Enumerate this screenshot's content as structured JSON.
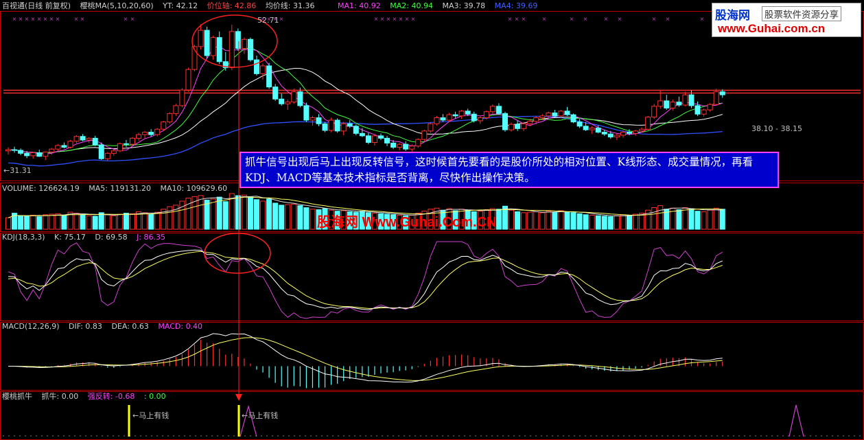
{
  "header": {
    "price": {
      "app": "百视通(日线 前复权)",
      "indicator": "樱桃MA(5,10,20,60)",
      "yt": "YT: 42.12",
      "pivot": "价位轴: 42.86",
      "avg": "均价线: 31.36",
      "ma1": "MA1: 40.92",
      "ma2": "MA2: 40.94",
      "ma3": "MA3: 39.78",
      "ma4": "MA4: 39.69"
    },
    "volume": {
      "vol": "VOLUME: 126624.19",
      "ma5": "MA5: 119131.20",
      "ma10": "MA10: 109629.60"
    },
    "kdj": {
      "name": "KDJ(18,3,3)",
      "k": "K: 75.17",
      "d": "D: 69.58",
      "j": "J: 86.35"
    },
    "macd": {
      "name": "MACD(12,26,9)",
      "dif": "DIF: 0.83",
      "dea": "DEA: 0.63",
      "macd": "MACD: 0.40"
    },
    "signal": {
      "name": "樱桃抓牛",
      "grab": "抓牛: 0.00",
      "rev": "强反转: -0.68",
      "zero": ": 0.00"
    }
  },
  "annotation": "抓牛信号出现后马上出现反转信号，这时候首先要看的是股价所处的相对位置、K线形态、成交量情况，再看KDJ、MACD等基本技术指标是否背离，尽快作出操作决策。",
  "logo": {
    "name": "股海网",
    "tag": "股票软件资源分享",
    "url": "www.Guhai.com.cn"
  },
  "watermark": "股海网 Www.Guhai.Com.CN",
  "labels": {
    "low_price": "←31.31",
    "peak_price": "52.71",
    "range": "38.10 - 38.15",
    "signal_left": "←马上有钱",
    "signal_right": "←马上有钱"
  },
  "colors": {
    "bg": "#000000",
    "up": "#ff3030",
    "down": "#54ffff",
    "ma1": "#ffffff",
    "ma2": "#ff40ff",
    "ma3": "#40ff40",
    "ma4": "#3050ff",
    "frame": "#c00000",
    "yellow": "#ffff00"
  },
  "chart_data": {
    "type": "candlestick",
    "xlabel": "",
    "ylabel": "",
    "ylim": [
      28,
      56
    ],
    "resistance": [
      42.4,
      42.86
    ],
    "ohlc": [
      [
        32.8,
        33.4,
        32.2,
        33.0
      ],
      [
        33.0,
        33.5,
        32.5,
        32.9
      ],
      [
        32.9,
        33.2,
        32.1,
        32.4
      ],
      [
        32.4,
        32.8,
        31.6,
        32.0
      ],
      [
        32.0,
        32.6,
        31.5,
        32.5
      ],
      [
        32.5,
        33.0,
        31.8,
        31.9
      ],
      [
        31.9,
        32.7,
        31.3,
        32.6
      ],
      [
        32.6,
        33.3,
        32.2,
        33.1
      ],
      [
        33.1,
        33.9,
        32.8,
        33.7
      ],
      [
        33.7,
        34.2,
        33.2,
        33.4
      ],
      [
        33.4,
        34.6,
        33.2,
        34.4
      ],
      [
        34.4,
        35.4,
        34.1,
        35.2
      ],
      [
        35.2,
        35.6,
        34.4,
        34.6
      ],
      [
        34.6,
        35.1,
        34.1,
        34.9
      ],
      [
        34.9,
        35.3,
        33.6,
        33.8
      ],
      [
        33.8,
        34.2,
        31.3,
        31.5
      ],
      [
        31.5,
        32.6,
        31.2,
        32.4
      ],
      [
        32.4,
        33.1,
        32.0,
        32.8
      ],
      [
        32.8,
        34.2,
        32.6,
        34.0
      ],
      [
        34.0,
        34.6,
        33.4,
        33.9
      ],
      [
        33.9,
        35.1,
        33.6,
        34.9
      ],
      [
        34.9,
        35.8,
        34.5,
        35.5
      ],
      [
        35.5,
        36.1,
        34.8,
        35.9
      ],
      [
        35.9,
        36.4,
        35.2,
        35.5
      ],
      [
        35.5,
        36.6,
        35.2,
        36.4
      ],
      [
        36.4,
        37.8,
        36.1,
        37.6
      ],
      [
        37.6,
        39.2,
        37.3,
        39.0
      ],
      [
        39.0,
        40.6,
        38.6,
        40.3
      ],
      [
        40.3,
        43.2,
        40.0,
        42.9
      ],
      [
        42.9,
        46.6,
        42.6,
        46.3
      ],
      [
        46.3,
        50.4,
        46.0,
        50.1
      ],
      [
        50.1,
        53.8,
        49.6,
        52.8
      ],
      [
        52.8,
        53.4,
        48.1,
        48.6
      ],
      [
        48.6,
        51.9,
        47.9,
        51.6
      ],
      [
        51.6,
        52.6,
        47.2,
        47.6
      ],
      [
        47.6,
        49.2,
        46.1,
        46.6
      ],
      [
        46.6,
        53.7,
        46.2,
        52.6
      ],
      [
        52.6,
        53.1,
        49.4,
        49.8
      ],
      [
        49.8,
        51.6,
        48.9,
        51.3
      ],
      [
        51.3,
        51.6,
        47.6,
        47.9
      ],
      [
        47.9,
        48.6,
        45.3,
        45.6
      ],
      [
        45.6,
        47.3,
        44.6,
        46.9
      ],
      [
        46.9,
        47.4,
        43.1,
        43.4
      ],
      [
        43.4,
        43.9,
        41.1,
        41.4
      ],
      [
        41.4,
        42.3,
        40.3,
        40.6
      ],
      [
        40.6,
        41.3,
        39.6,
        40.9
      ],
      [
        40.9,
        43.1,
        40.6,
        42.6
      ],
      [
        42.6,
        43.3,
        40.0,
        40.3
      ],
      [
        40.3,
        40.8,
        37.6,
        37.9
      ],
      [
        37.9,
        38.6,
        37.0,
        38.3
      ],
      [
        38.3,
        38.9,
        36.9,
        37.3
      ],
      [
        37.3,
        37.6,
        35.9,
        36.2
      ],
      [
        36.2,
        38.3,
        35.9,
        37.9
      ],
      [
        37.9,
        38.2,
        35.8,
        36.1
      ],
      [
        36.1,
        37.6,
        35.4,
        37.3
      ],
      [
        37.3,
        37.9,
        36.6,
        36.9
      ],
      [
        36.9,
        37.2,
        35.4,
        35.7
      ],
      [
        35.7,
        36.6,
        35.1,
        35.3
      ],
      [
        35.3,
        35.8,
        33.9,
        34.2
      ],
      [
        34.2,
        35.6,
        33.7,
        35.3
      ],
      [
        35.3,
        35.7,
        34.6,
        34.9
      ],
      [
        34.9,
        35.3,
        33.6,
        34.1
      ],
      [
        34.1,
        34.6,
        33.1,
        33.4
      ],
      [
        33.4,
        34.1,
        32.9,
        33.9
      ],
      [
        33.9,
        34.4,
        32.8,
        33.1
      ],
      [
        33.1,
        33.9,
        32.7,
        33.6
      ],
      [
        33.6,
        34.9,
        33.3,
        34.7
      ],
      [
        34.7,
        36.3,
        34.4,
        36.1
      ],
      [
        36.1,
        37.6,
        35.8,
        37.3
      ],
      [
        37.3,
        38.6,
        37.0,
        38.3
      ],
      [
        38.3,
        38.9,
        37.6,
        37.9
      ],
      [
        37.9,
        39.1,
        37.6,
        38.8
      ],
      [
        38.8,
        39.3,
        38.2,
        38.6
      ],
      [
        38.6,
        39.6,
        38.1,
        39.4
      ],
      [
        39.4,
        39.8,
        38.6,
        38.9
      ],
      [
        38.9,
        39.3,
        37.5,
        37.8
      ],
      [
        37.8,
        38.6,
        37.3,
        38.3
      ],
      [
        38.3,
        39.5,
        38.0,
        39.3
      ],
      [
        39.3,
        40.5,
        39.0,
        40.2
      ],
      [
        40.2,
        40.7,
        38.8,
        39.0
      ],
      [
        39.0,
        39.3,
        36.0,
        36.3
      ],
      [
        36.3,
        37.5,
        36.0,
        37.2
      ],
      [
        37.2,
        37.8,
        36.1,
        36.5
      ],
      [
        36.5,
        37.6,
        36.1,
        37.3
      ],
      [
        37.3,
        38.1,
        36.9,
        37.7
      ],
      [
        37.7,
        38.6,
        37.2,
        38.3
      ],
      [
        38.3,
        38.9,
        37.9,
        38.6
      ],
      [
        38.6,
        39.3,
        38.1,
        39.1
      ],
      [
        39.1,
        39.6,
        38.3,
        38.6
      ],
      [
        38.6,
        39.6,
        38.2,
        39.4
      ],
      [
        39.4,
        40.1,
        38.6,
        38.8
      ],
      [
        38.8,
        39.0,
        37.4,
        37.6
      ],
      [
        37.6,
        38.1,
        36.6,
        36.9
      ],
      [
        36.9,
        37.6,
        36.1,
        36.3
      ],
      [
        36.3,
        36.9,
        35.6,
        36.6
      ],
      [
        36.6,
        37.0,
        35.7,
        35.9
      ],
      [
        35.9,
        36.3,
        35.3,
        35.6
      ],
      [
        35.6,
        36.1,
        34.8,
        35.1
      ],
      [
        35.1,
        35.7,
        34.6,
        35.4
      ],
      [
        35.4,
        36.2,
        35.0,
        35.9
      ],
      [
        35.9,
        36.4,
        35.4,
        35.7
      ],
      [
        35.7,
        36.3,
        35.3,
        36.1
      ],
      [
        36.1,
        36.7,
        35.8,
        36.4
      ],
      [
        36.4,
        38.6,
        36.2,
        38.4
      ],
      [
        38.4,
        40.6,
        38.1,
        40.2
      ],
      [
        40.2,
        42.9,
        39.8,
        41.1
      ],
      [
        41.1,
        42.1,
        39.6,
        39.9
      ],
      [
        39.9,
        41.3,
        39.5,
        40.9
      ],
      [
        40.9,
        41.8,
        40.1,
        40.4
      ],
      [
        40.4,
        42.6,
        40.2,
        42.1
      ],
      [
        42.1,
        42.9,
        39.9,
        40.3
      ],
      [
        40.3,
        41.0,
        38.6,
        38.9
      ],
      [
        38.9,
        39.8,
        38.5,
        39.6
      ],
      [
        39.6,
        40.7,
        39.3,
        40.5
      ],
      [
        40.5,
        43.1,
        40.3,
        42.6
      ],
      [
        42.6,
        43.0,
        41.6,
        42.1
      ]
    ],
    "volume": [
      46,
      64,
      54,
      52,
      56,
      50,
      58,
      60,
      62,
      56,
      68,
      64,
      58,
      54,
      52,
      66,
      58,
      54,
      60,
      64,
      62,
      70,
      66,
      60,
      68,
      80,
      90,
      96,
      112,
      124,
      130,
      134,
      116,
      120,
      128,
      110,
      142,
      134,
      136,
      128,
      118,
      112,
      120,
      104,
      96,
      98,
      100,
      94,
      86,
      80,
      78,
      82,
      76,
      72,
      74,
      70,
      68,
      72,
      66,
      64,
      62,
      60,
      58,
      56,
      54,
      56,
      64,
      72,
      80,
      84,
      76,
      82,
      74,
      80,
      76,
      70,
      72,
      78,
      82,
      80,
      92,
      76,
      70,
      66,
      68,
      70,
      66,
      72,
      68,
      74,
      70,
      66,
      62,
      58,
      56,
      54,
      52,
      50,
      54,
      58,
      56,
      60,
      64,
      76,
      86,
      94,
      80,
      84,
      78,
      86,
      82,
      72,
      70,
      76,
      84,
      80
    ],
    "kdj": {
      "k": [],
      "d": [],
      "j": []
    },
    "macd_hist": [],
    "signals": {
      "grab": [],
      "reverse": []
    }
  }
}
